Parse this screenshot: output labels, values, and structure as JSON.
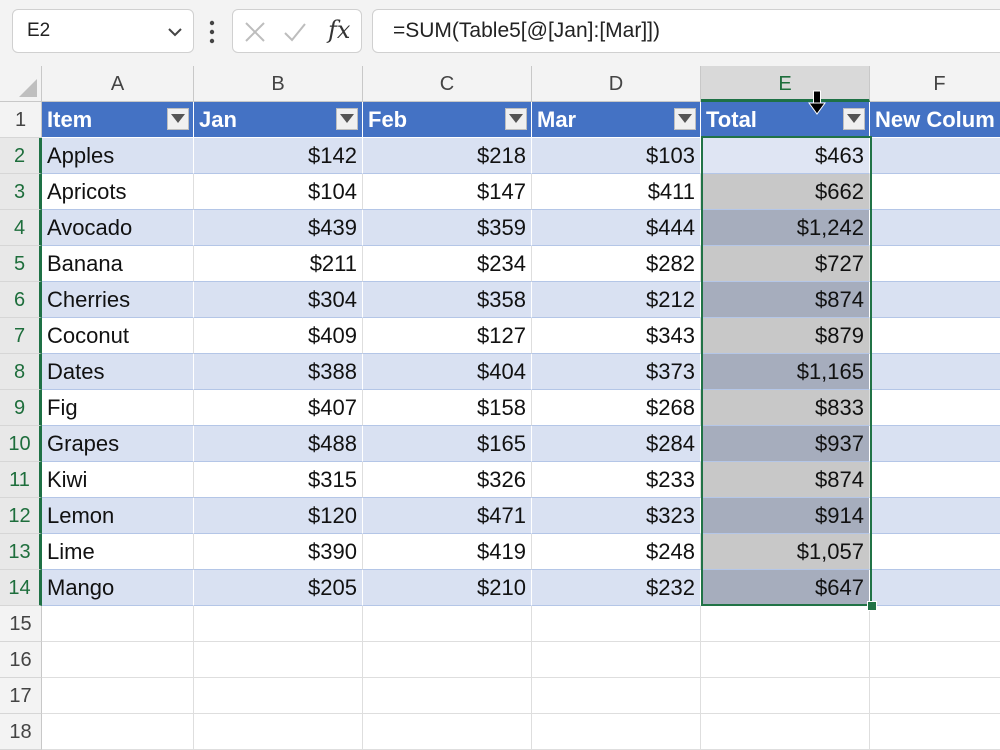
{
  "namebox": {
    "value": "E2"
  },
  "formula": {
    "value": "=SUM(Table5[@[Jan]:[Mar]])",
    "fx_label": "fx"
  },
  "columns": [
    "A",
    "B",
    "C",
    "D",
    "E",
    "F"
  ],
  "rows": [
    "1",
    "2",
    "3",
    "4",
    "5",
    "6",
    "7",
    "8",
    "9",
    "10",
    "11",
    "12",
    "13",
    "14",
    "15",
    "16",
    "17",
    "18"
  ],
  "table": {
    "headers": [
      "Item",
      "Jan",
      "Feb",
      "Mar",
      "Total",
      "New Colum"
    ],
    "data": [
      [
        "Apples",
        "$142",
        "$218",
        "$103",
        "$463"
      ],
      [
        "Apricots",
        "$104",
        "$147",
        "$411",
        "$662"
      ],
      [
        "Avocado",
        "$439",
        "$359",
        "$444",
        "$1,242"
      ],
      [
        "Banana",
        "$211",
        "$234",
        "$282",
        "$727"
      ],
      [
        "Cherries",
        "$304",
        "$358",
        "$212",
        "$874"
      ],
      [
        "Coconut",
        "$409",
        "$127",
        "$343",
        "$879"
      ],
      [
        "Dates",
        "$388",
        "$404",
        "$373",
        "$1,165"
      ],
      [
        "Fig",
        "$407",
        "$158",
        "$268",
        "$833"
      ],
      [
        "Grapes",
        "$488",
        "$165",
        "$284",
        "$937"
      ],
      [
        "Kiwi",
        "$315",
        "$326",
        "$233",
        "$874"
      ],
      [
        "Lemon",
        "$120",
        "$471",
        "$323",
        "$914"
      ],
      [
        "Lime",
        "$390",
        "$419",
        "$248",
        "$1,057"
      ],
      [
        "Mango",
        "$205",
        "$210",
        "$232",
        "$647"
      ]
    ]
  },
  "colors": {
    "header": "#4472c4",
    "band": "#d9e1f2",
    "selection": "#217346"
  }
}
